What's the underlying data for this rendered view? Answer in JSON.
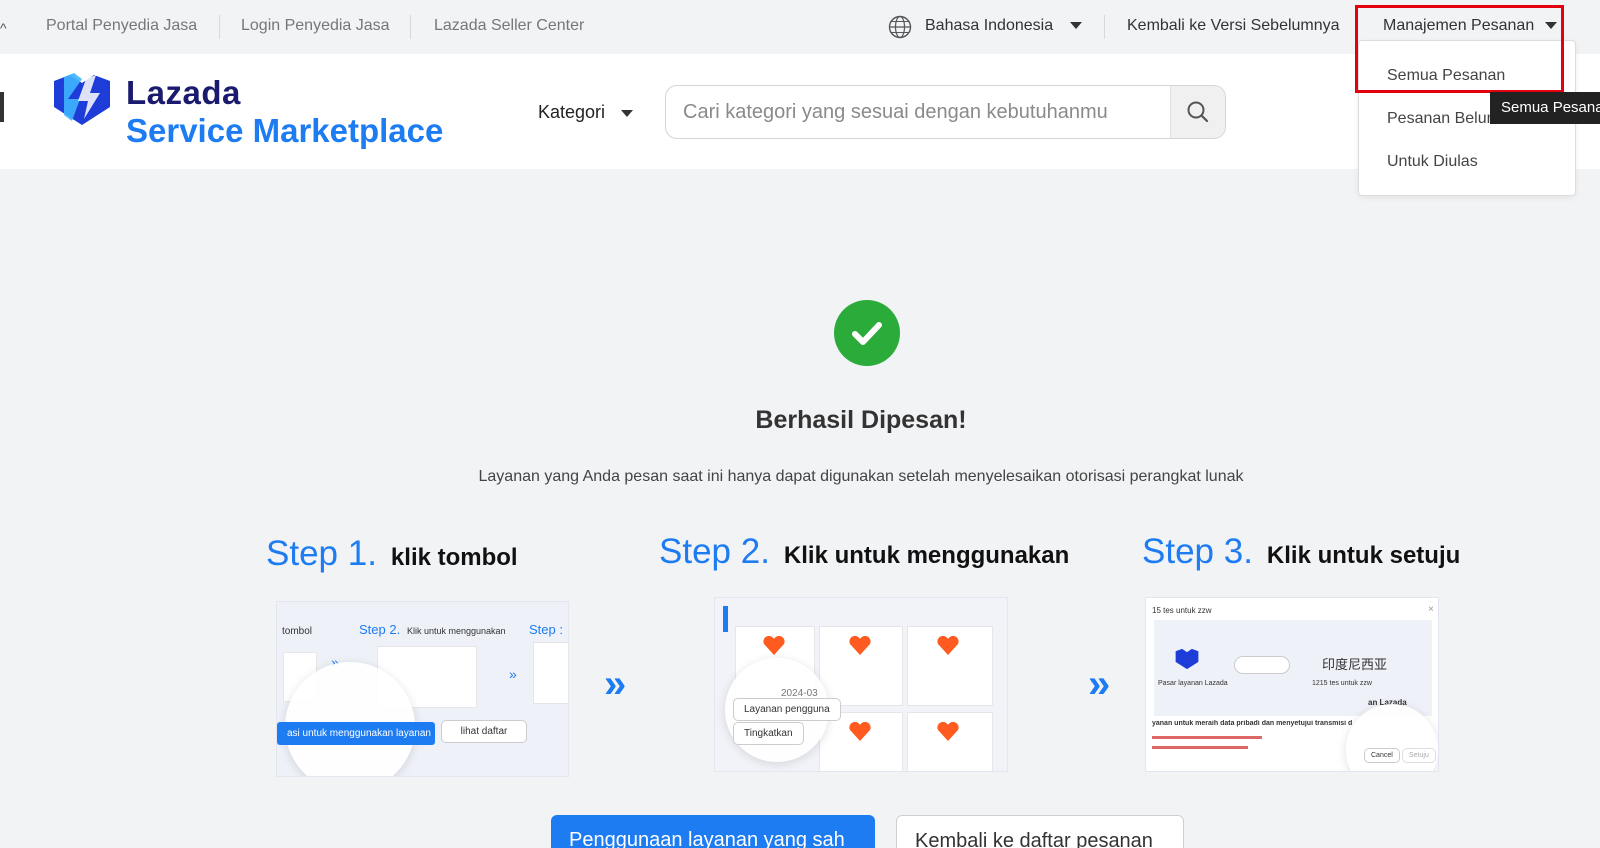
{
  "topbar": {
    "left_links": [
      "Portal Penyedia Jasa",
      "Login Penyedia Jasa",
      "Lazada Seller Center"
    ],
    "language": "Bahasa Indonesia",
    "back_version": "Kembali ke Versi Sebelumnya",
    "order_menu": "Manajemen Pesanan"
  },
  "header": {
    "logo_top": "Lazada",
    "logo_bottom": "Service Marketplace",
    "category_label": "Kategori",
    "search_placeholder": "Cari kategori yang sesuai dengan kebutuhanmu"
  },
  "dropdown": {
    "items": [
      "Semua Pesanan",
      "Pesanan Belum Dibuat",
      "Untuk Diulas"
    ],
    "tooltip": "Semua Pesanan"
  },
  "main": {
    "title": "Berhasil Dipesan!",
    "subtitle": "Layanan yang Anda pesan saat ini hanya dapat digunakan setelah menyelesaikan otorisasi perangkat lunak",
    "steps": [
      {
        "num": "Step 1.",
        "text": "klik tombol"
      },
      {
        "num": "Step 2.",
        "text": "Klik untuk menggunakan"
      },
      {
        "num": "Step 3.",
        "text": "Klik untuk setuju"
      }
    ],
    "shot1": {
      "t1": "tombol",
      "t2": "Step 2.",
      "t3": "Klik untuk menggunakan",
      "t4": "Step :",
      "btn_primary": "asi untuk menggunakan layanan",
      "btn_secondary": "lihat daftar"
    },
    "shot2": {
      "date_label": "2024-03",
      "pill1": "Layanan pengguna",
      "pill2": "Tingkatkan"
    },
    "shot3": {
      "head": "15 tes untuk zzw",
      "left_label": "Pasar layanan Lazada",
      "right_logo": "印度尼西亚",
      "right_label": "1215 tes untuk zzw",
      "lazada_label": "an Lazada",
      "consent": "yanan untuk meraih data pribadi dan menyetujui transmisi data",
      "cancel": "Cancel",
      "agree": "Setuju"
    },
    "primary_button": "Penggunaan layanan yang sah",
    "secondary_button": "Kembali ke daftar pesanan"
  },
  "colors": {
    "brand_blue": "#1d7cf2",
    "brand_navy": "#1a1a6e",
    "success_green": "#2aab3a",
    "highlight_red": "#e3000f"
  }
}
